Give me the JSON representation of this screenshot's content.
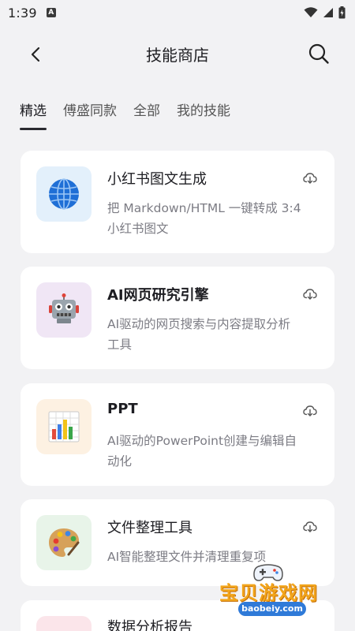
{
  "status_bar": {
    "time": "1:39",
    "badge": "A"
  },
  "header": {
    "title": "技能商店",
    "back_icon": "chevron-left-icon",
    "search_icon": "search-icon"
  },
  "tabs": [
    {
      "label": "精选",
      "active": true
    },
    {
      "label": "傅盛同款",
      "active": false
    },
    {
      "label": "全部",
      "active": false
    },
    {
      "label": "我的技能",
      "active": false
    }
  ],
  "cards": [
    {
      "title": "小红书图文生成",
      "description_lines": [
        "把 Markdown/HTML 一键转成 3:4",
        "小红书图文"
      ],
      "icon": "globe-icon",
      "icon_bg": "#e3f0fb",
      "download_icon": "cloud-download-icon"
    },
    {
      "title": "AI网页研究引擎",
      "description_lines": [
        "AI驱动的网页搜索与内容提取分析",
        "工具"
      ],
      "icon": "robot-icon",
      "icon_bg": "#f0e6f5",
      "download_icon": "cloud-download-icon"
    },
    {
      "title": "PPT",
      "description_lines": [
        "AI驱动的PowerPoint创建与编辑自",
        "动化"
      ],
      "icon": "bar-chart-icon",
      "icon_bg": "#fdf1e2",
      "download_icon": "cloud-download-icon"
    },
    {
      "title": "文件整理工具",
      "description_lines": [
        "AI智能整理文件并清理重复项"
      ],
      "icon": "palette-icon",
      "icon_bg": "#e8f4e9",
      "download_icon": "cloud-download-icon"
    },
    {
      "title": "数据分析报告",
      "description_lines": [
        ""
      ],
      "icon": "chart-icon",
      "icon_bg": "#fbe5ea",
      "download_icon": "cloud-download-icon"
    }
  ],
  "watermark": {
    "text": "宝贝游戏网",
    "url": "baobeiy.com"
  }
}
